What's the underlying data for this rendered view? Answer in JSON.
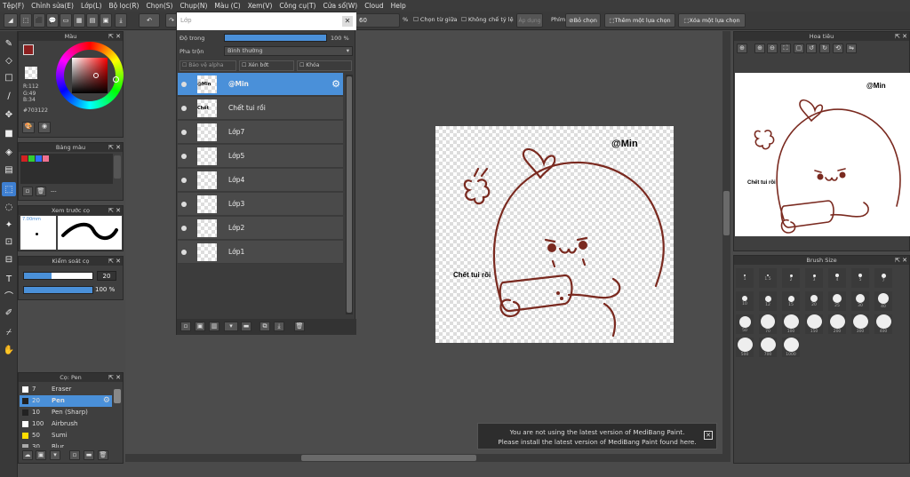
{
  "menu": [
    "Tệp(F)",
    "Chỉnh sửa(E)",
    "Lớp(L)",
    "Bộ lọc(R)",
    "Chọn(S)",
    "Chụp(N)",
    "Màu (C)",
    "Xem(V)",
    "Công cụ(T)",
    "Cửa sổ(W)",
    "Cloud",
    "Help"
  ],
  "toolbar": {
    "zoom_value": "60",
    "percent": "%",
    "option1": "Chọn từ giữa",
    "option2": "Không chế tỷ lệ",
    "apply_label": "Áp dụng",
    "key_label": "Phím",
    "deselect": "Bỏ chọn",
    "add_selection": "Thêm một lựa chọn",
    "remove_selection": "Xóa một lựa chọn"
  },
  "color_panel": {
    "title": "Màu",
    "r": "R:112",
    "g": "G:49",
    "b": "B:34",
    "hex": "#703122",
    "primary": "#8c1f1f",
    "hue_marker": "#ff0000"
  },
  "palette_panel": {
    "title": "Bảng màu",
    "swatches": [
      "#d22222",
      "#33cc33",
      "#2f6fff",
      "#f07090"
    ],
    "name": "---"
  },
  "preview_panel": {
    "title": "Xem trước cọ",
    "size": "7.00mm"
  },
  "brush_control": {
    "title": "Kiểm soát cọ",
    "size": "20",
    "opacity": "100",
    "percent": "%",
    "size_fill": 0.4,
    "opacity_fill": 1.0
  },
  "brush_list": {
    "title": "Cọ: Pen",
    "items": [
      {
        "size": "7",
        "name": "Eraser",
        "color": "#ffffff"
      },
      {
        "size": "20",
        "name": "Pen",
        "color": "#222222"
      },
      {
        "size": "10",
        "name": "Pen (Sharp)",
        "color": "#222222"
      },
      {
        "size": "100",
        "name": "Airbrush",
        "color": "#ffffff"
      },
      {
        "size": "50",
        "name": "Sumi",
        "color": "#ffdd00"
      },
      {
        "size": "30",
        "name": "Blur",
        "color": "#aaaaaa"
      }
    ]
  },
  "layer_panel": {
    "title": "Lớp",
    "opacity_label": "Độ trong",
    "opacity_value": "100 %",
    "opacity_fill": 1.0,
    "blend_label": "Pha trộn",
    "blend_value": "Bình thường",
    "protect_alpha": "Bảo vệ alpha",
    "clipping": "Xén bớt",
    "lock": "Khóa",
    "layers": [
      {
        "name": "@Min",
        "thumb": "@Min"
      },
      {
        "name": "Chết tui rồi",
        "thumb": "Chết tui rồi"
      },
      {
        "name": "Lớp7",
        "thumb": ""
      },
      {
        "name": "Lớp5",
        "thumb": ""
      },
      {
        "name": "Lớp4",
        "thumb": ""
      },
      {
        "name": "Lớp3",
        "thumb": ""
      },
      {
        "name": "Lớp2",
        "thumb": ""
      },
      {
        "name": "Lớp1",
        "thumb": ""
      }
    ]
  },
  "navigator": {
    "title": "Hoa tiêu",
    "text1": "@Min",
    "text2": "Chết tui rồi"
  },
  "canvas": {
    "text1": "@Min",
    "text2": "Chết tui rồi",
    "line_color": "#7a2a20"
  },
  "brush_size": {
    "title": "Brush Size",
    "sizes": [
      "1",
      "1.5",
      "2",
      "3",
      "4",
      "5",
      "7",
      "10",
      "12",
      "15",
      "20",
      "25",
      "30",
      "40",
      "50",
      "70",
      "100",
      "150",
      "200",
      "300",
      "400",
      "500",
      "700",
      "1000"
    ]
  },
  "notification": {
    "line1": "You are not using the latest version of MediBang Paint.",
    "line2": "Please install the latest version of MediBang Paint found here."
  }
}
